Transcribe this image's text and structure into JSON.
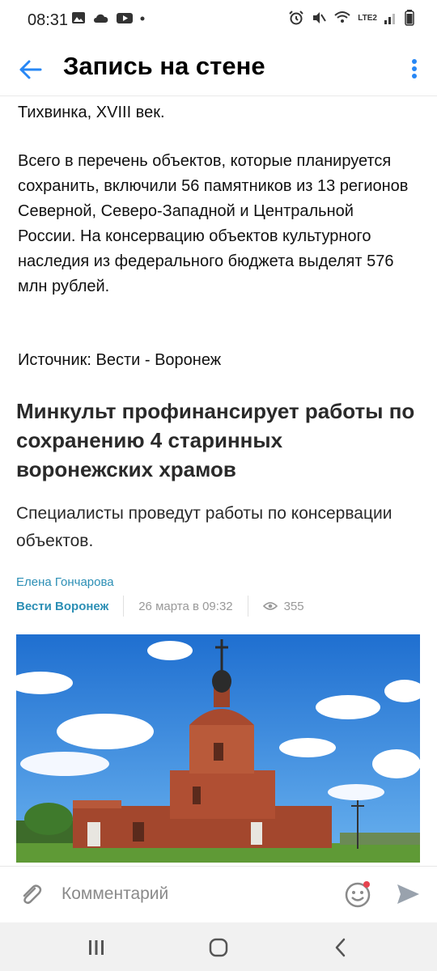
{
  "status_bar": {
    "time": "08:31",
    "network": "LTE2"
  },
  "header": {
    "title": "Запись на стене"
  },
  "post": {
    "paragraphs": [
      "Тихвинка, XVIII век.",
      "Всего в перечень объектов, которые планируется сохранить, включили 56 памятников из 13 регионов Северной, Северо-Западной и Центральной России. На консервацию объектов культурного наследия из федерального бюджета выделят 576 млн рублей.",
      "Источник: Вести - Воронеж"
    ]
  },
  "article": {
    "title": "Минкульт профинансирует работы по сохранению 4 старинных воронежских храмов",
    "lead": "Специалисты проведут работы по консервации объектов.",
    "author": "Елена Гончарова",
    "source": "Вести Воронеж",
    "date": "26 марта в 09:32",
    "views": "355"
  },
  "comment_bar": {
    "placeholder": "Комментарий"
  },
  "colors": {
    "accent": "#2c8fb5",
    "back_arrow": "#2787f5"
  }
}
